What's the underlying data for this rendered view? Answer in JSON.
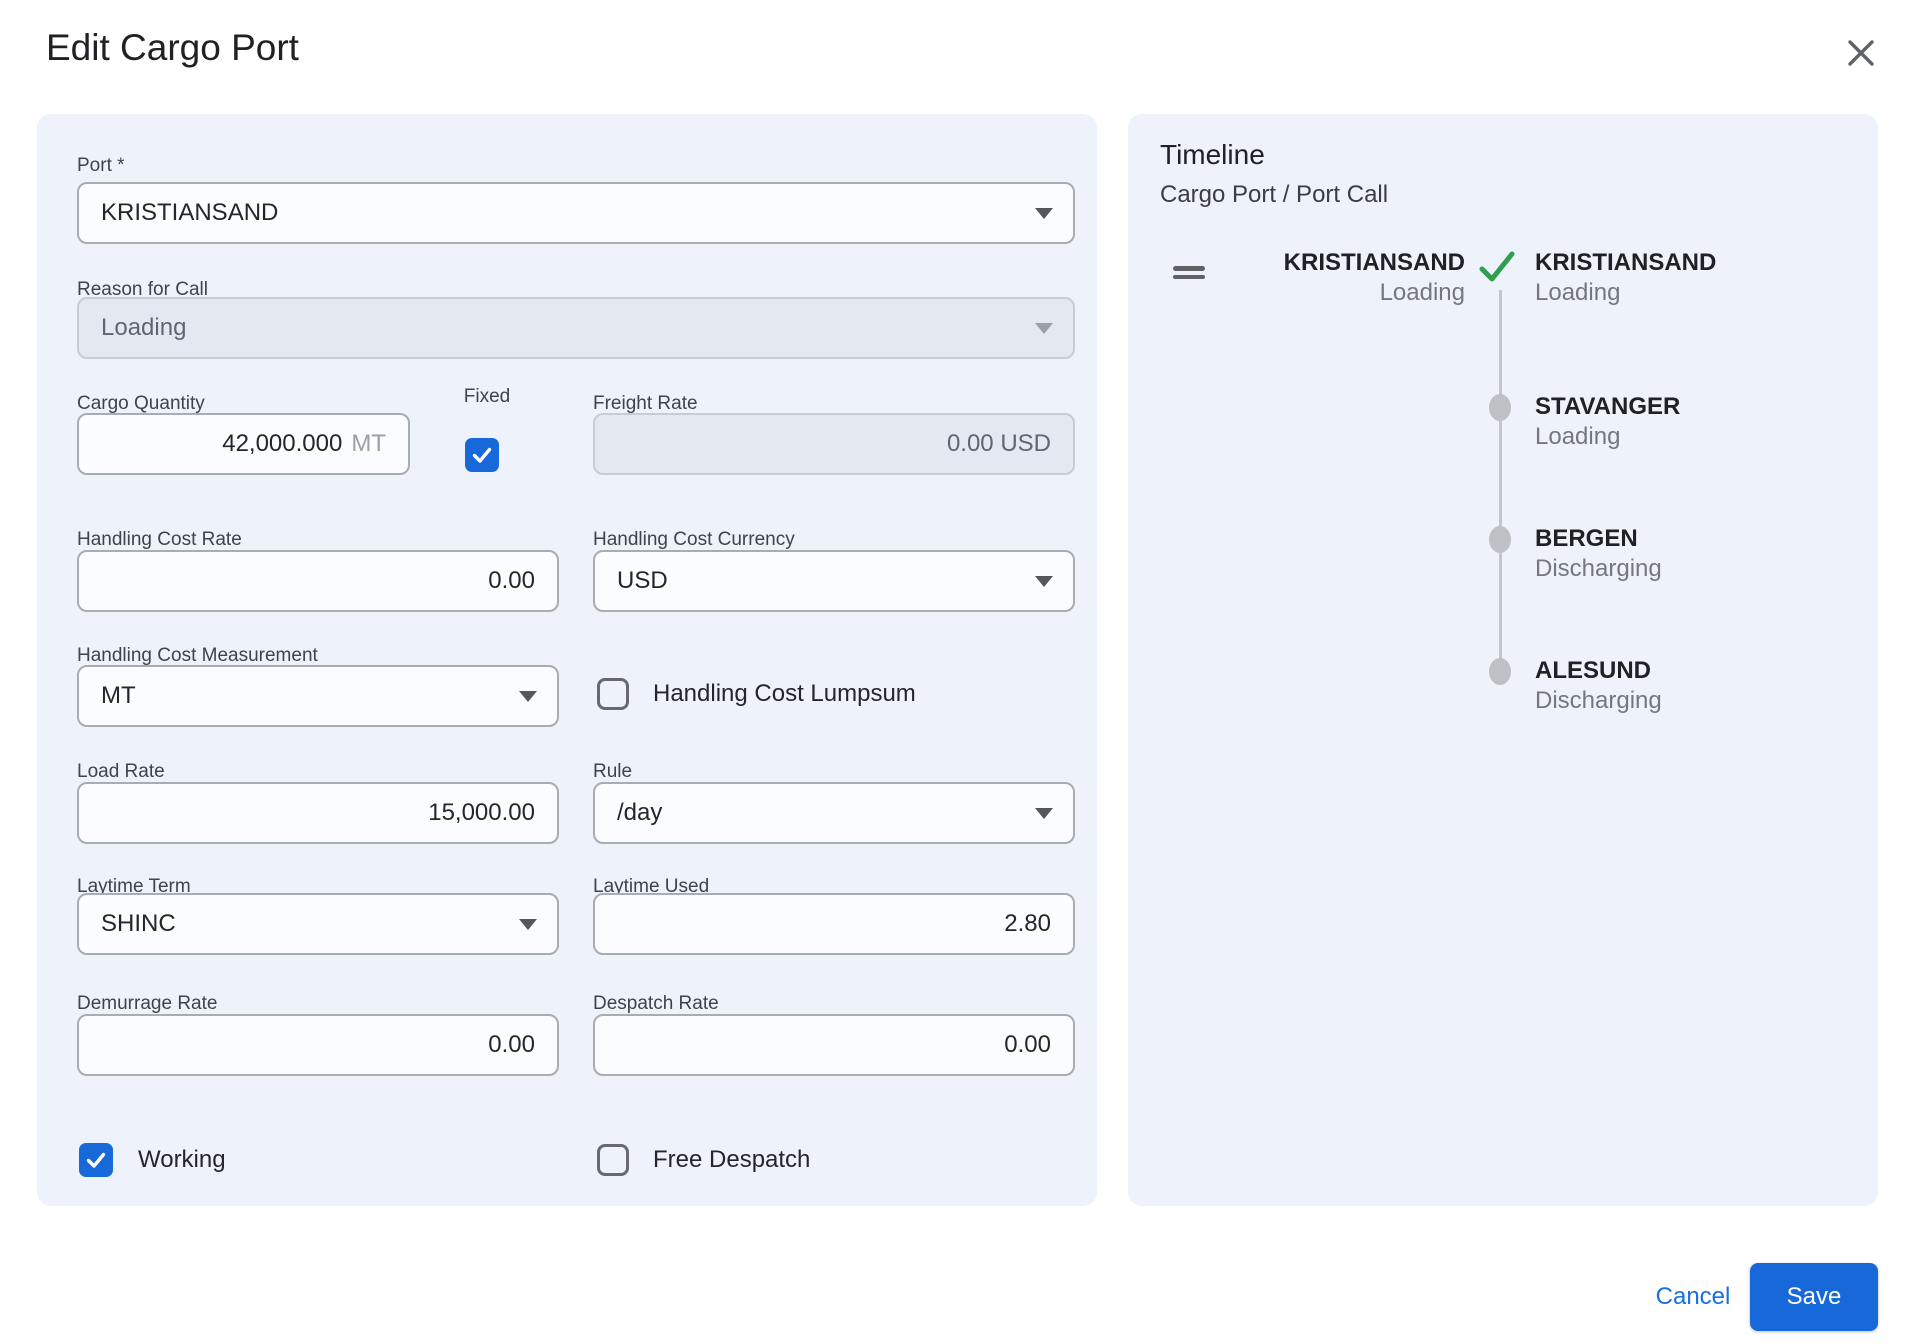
{
  "title": "Edit Cargo Port",
  "form": {
    "port": {
      "label": "Port *",
      "value": "KRISTIANSAND"
    },
    "reason_for_call": {
      "label": "Reason for Call",
      "value": "Loading",
      "disabled": true
    },
    "cargo_quantity": {
      "label": "Cargo Quantity",
      "value": "42,000.000",
      "unit": "MT"
    },
    "fixed": {
      "label": "Fixed",
      "checked": true
    },
    "freight_rate": {
      "label": "Freight Rate",
      "value": "0.00 USD",
      "disabled": true
    },
    "handling_cost_rate": {
      "label": "Handling Cost Rate",
      "value": "0.00"
    },
    "handling_cost_currency": {
      "label": "Handling Cost Currency",
      "value": "USD"
    },
    "handling_cost_measurement": {
      "label": "Handling Cost Measurement",
      "value": "MT"
    },
    "handling_cost_lumpsum": {
      "label": "Handling Cost Lumpsum",
      "checked": false
    },
    "load_rate": {
      "label": "Load Rate",
      "value": "15,000.00"
    },
    "rule": {
      "label": "Rule",
      "value": "/day"
    },
    "laytime_term": {
      "label": "Laytime Term",
      "value": "SHINC"
    },
    "laytime_used": {
      "label": "Laytime Used",
      "value": "2.80"
    },
    "demurrage_rate": {
      "label": "Demurrage Rate",
      "value": "0.00"
    },
    "despatch_rate": {
      "label": "Despatch Rate",
      "value": "0.00"
    },
    "working": {
      "label": "Working",
      "checked": true
    },
    "free_despatch": {
      "label": "Free Despatch",
      "checked": false
    }
  },
  "timeline": {
    "title": "Timeline",
    "subtitle": "Cargo Port / Port Call",
    "current": {
      "port": "KRISTIANSAND",
      "reason": "Loading"
    },
    "stops": [
      {
        "port": "KRISTIANSAND",
        "reason": "Loading",
        "marker": "check"
      },
      {
        "port": "STAVANGER",
        "reason": "Loading",
        "marker": "dot"
      },
      {
        "port": "BERGEN",
        "reason": "Discharging",
        "marker": "dot"
      },
      {
        "port": "ALESUND",
        "reason": "Discharging",
        "marker": "dot"
      }
    ]
  },
  "actions": {
    "cancel": "Cancel",
    "save": "Save"
  },
  "colors": {
    "accent_blue": "#1768d8",
    "link_blue": "#1a6fe0",
    "success_green": "#2e9e4f",
    "panel_background": "#edf2fb",
    "field_border": "#a9acb0",
    "disabled_field_background": "#e4e8f0",
    "timeline_gray": "#bdc0c4"
  }
}
